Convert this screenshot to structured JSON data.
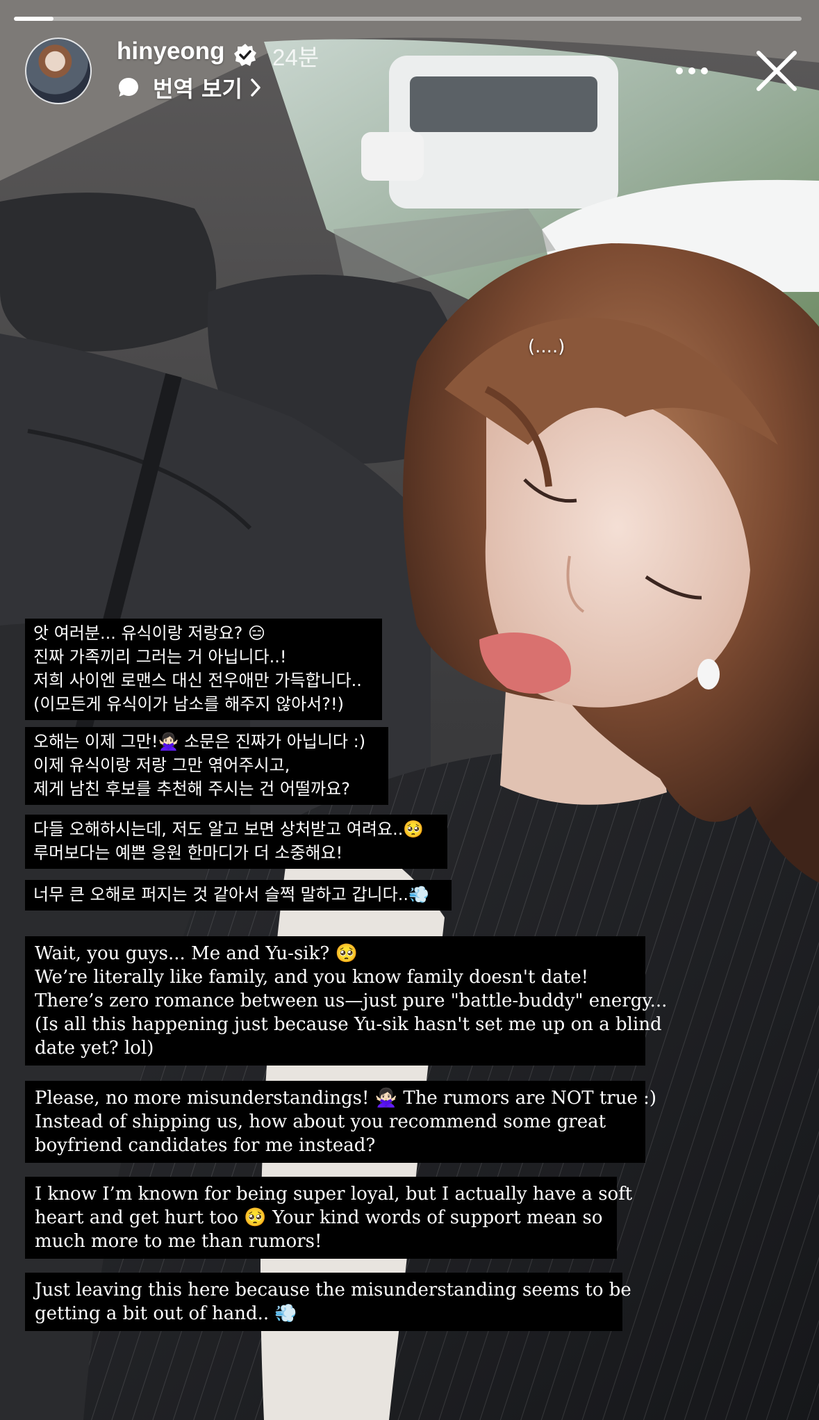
{
  "story": {
    "progress": 0.05,
    "username": "hinyeong",
    "time_ago": "24분",
    "translate_label": "번역 보기",
    "photo_note": "(....)",
    "icons": {
      "verified": "verified-badge-icon",
      "translate": "speech-bubble-icon",
      "chevron": "chevron-right-icon",
      "more": "more-icon",
      "close": "close-icon"
    }
  },
  "captions": {
    "kr1": [
      "앗 여러분... 유식이랑 저랑요? 😑",
      "진짜 가족끼리 그러는 거 아닙니다..!",
      "저희 사이엔 로맨스 대신 전우애만 가득합니다..",
      "(이모든게 유식이가 남소를 해주지 않아서?!)"
    ],
    "kr2": [
      "오해는 이제 그만!🙅🏻‍♀️ 소문은 진짜가 아닙니다 :)",
      "이제 유식이랑 저랑 그만 엮어주시고,",
      "제게 남친 후보를 추천해 주시는 건 어떨까요?"
    ],
    "kr3": [
      "다들 오해하시는데, 저도 알고 보면 상처받고 여려요..🥺",
      "루머보다는 예쁜 응원 한마디가 더 소중해요!"
    ],
    "kr4": [
      "너무 큰 오해로 퍼지는 것 같아서 슬쩍 말하고 갑니다..💨"
    ],
    "en1": [
      "Wait, you guys... Me and Yu-sik? 🥺",
      "We’re literally like family, and you know family doesn't date!",
      "There’s zero romance between us—just pure \"battle-buddy\" energy...",
      "(Is all this happening just because Yu-sik hasn't set me up on a blind",
      "date yet? lol)"
    ],
    "en2": [
      "Please, no more misunderstandings! 🙅🏻‍♀️ The rumors are NOT true :)",
      "Instead of shipping us, how about you recommend some great",
      "boyfriend candidates for me instead?"
    ],
    "en3": [
      "I know I’m known for being super loyal, but I actually have a soft",
      "heart and get hurt too 🥺 Your kind words of support mean so",
      "much more to me than rumors!"
    ],
    "en4": [
      "Just leaving this here because the misunderstanding seems to be",
      "getting a bit out of hand.. 💨"
    ]
  }
}
